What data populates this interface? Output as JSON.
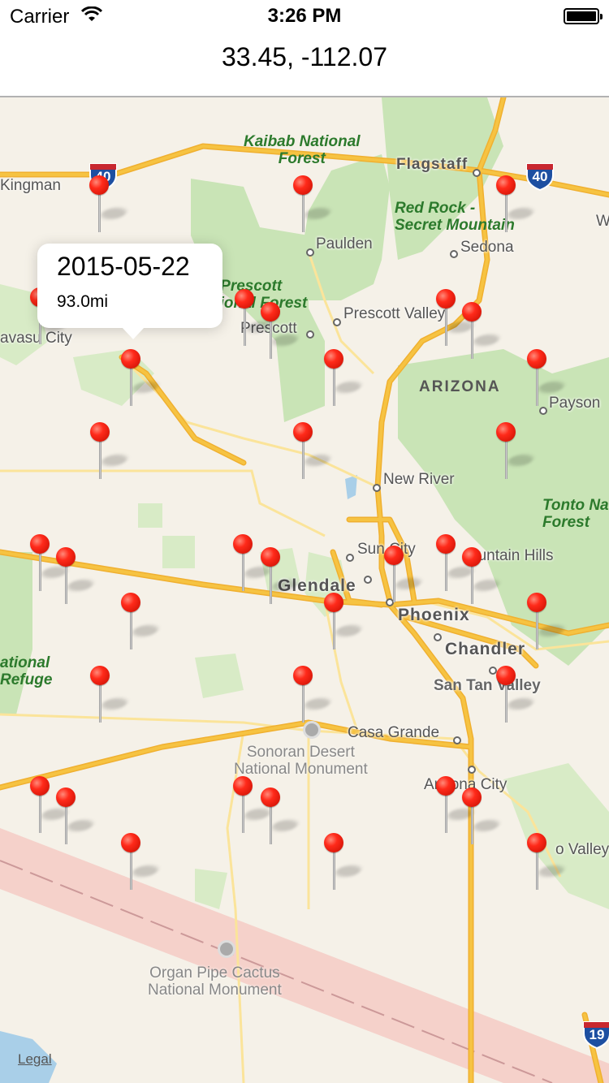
{
  "status_bar": {
    "carrier": "Carrier",
    "time": "3:26 PM",
    "battery_level": 1.0
  },
  "nav": {
    "title": "33.45, -112.07"
  },
  "callout": {
    "title": "2015-05-22",
    "subtitle": "93.0mi"
  },
  "map": {
    "legal": "Legal",
    "forests": {
      "kaibab": "Kaibab National\nForest",
      "red_rock": "Red Rock -\nSecret Mountain",
      "prescott_nf": "Prescott\nNational Forest",
      "tonto": "Tonto Na\nForest",
      "refuge": "ational\nRefuge"
    },
    "cities": {
      "kingman": "Kingman",
      "flagstaff": "Flagstaff",
      "paulden": "Paulden",
      "sedona": "Sedona",
      "prescott": "Prescott",
      "prescott_valley": "Prescott Valley",
      "payson": "Payson",
      "lake_havasu": "avasu City",
      "new_river": "New River",
      "sun_city": "Sun City",
      "fountain_hills": "ountain Hills",
      "casa_grande": "Casa Grande",
      "san_tan": "San Tan Valley",
      "arizona_city": "Arizona City",
      "oro_valley": "o Valley",
      "w": "W"
    },
    "big_cities": {
      "glendale": "Glendale",
      "phoenix": "Phoenix",
      "chandler": "Chandler"
    },
    "state": "ARIZONA",
    "parks": {
      "sonoran": "Sonoran Desert\nNational Monument",
      "organ_pipe": "Organ Pipe Cactus\nNational Monument"
    },
    "shields": {
      "i40_west": "40",
      "i40_east": "40",
      "i19": "19"
    },
    "colors": {
      "pin": "#ff2a1a",
      "highway": "#f6c342",
      "forest": "#c9e4b6",
      "background": "#f5f1e8"
    }
  }
}
